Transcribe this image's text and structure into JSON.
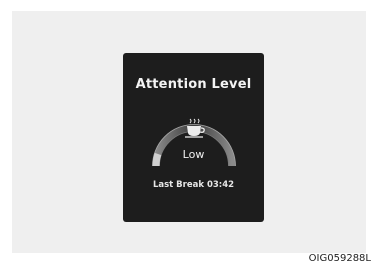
{
  "panel": {
    "title": "Attention Level",
    "level_text": "Low",
    "last_break": "Last Break 03:42",
    "level_fraction": 0.12
  },
  "gauge": {
    "icon": "coffee-cup-icon",
    "track_color": "#5a5a5a",
    "fill_color": "#bdbdbd"
  },
  "figure_id": "OIG059288L"
}
